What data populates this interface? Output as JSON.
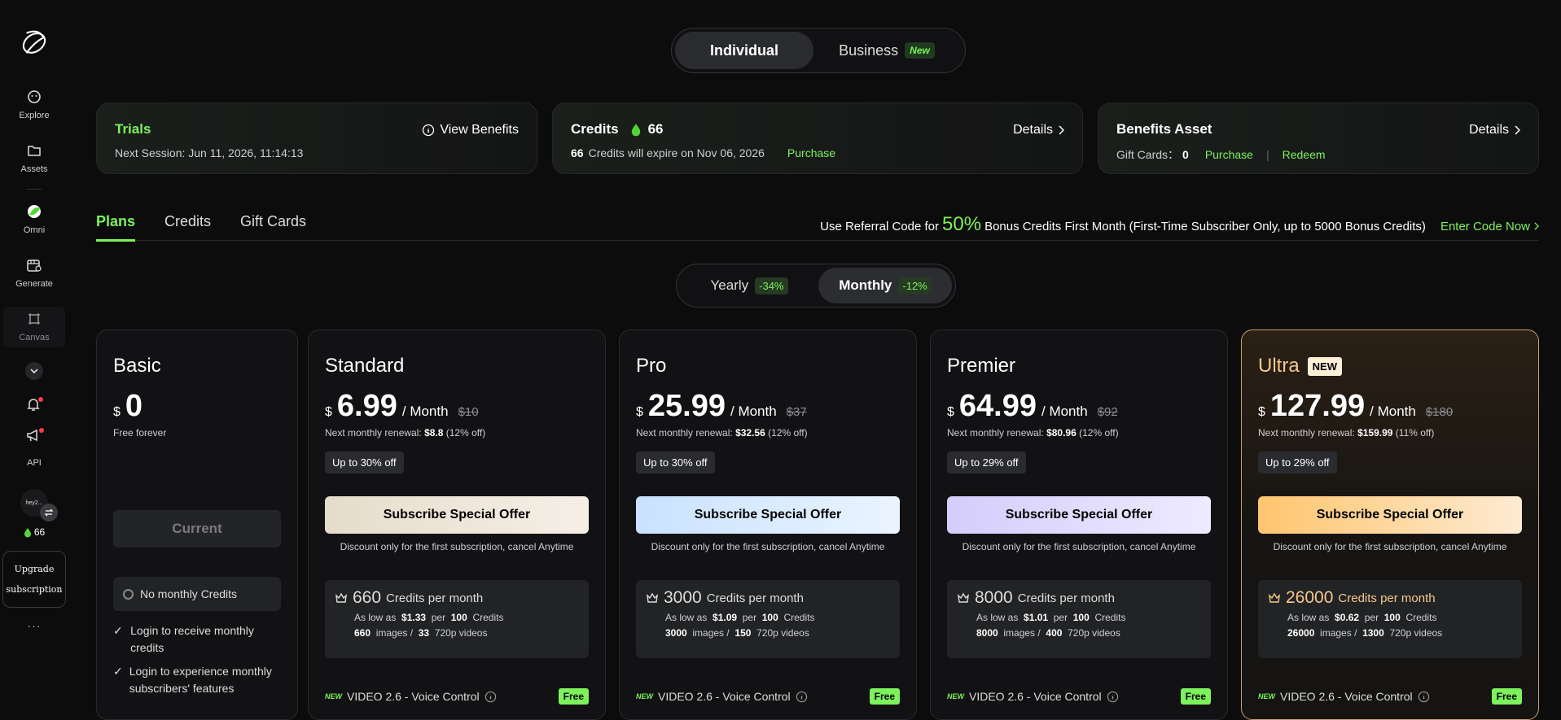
{
  "sidebar": {
    "items": [
      {
        "label": "Explore",
        "icon": "explore-icon"
      },
      {
        "label": "Assets",
        "icon": "folder-icon"
      },
      {
        "label": "Omni",
        "icon": "omni-icon"
      },
      {
        "label": "Generate",
        "icon": "generate-icon"
      },
      {
        "label": "Canvas",
        "icon": "canvas-icon"
      }
    ],
    "api_label": "API",
    "avatar_text": "hey2...",
    "credits": "66",
    "upgrade_line1": "Upgrade",
    "upgrade_line2": "subscription",
    "more": "···"
  },
  "top_segment": {
    "individual": "Individual",
    "business": "Business",
    "business_badge": "New"
  },
  "cards": {
    "trials": {
      "title": "Trials",
      "subtitle": "Next Session: Jun 11, 2026, 11:14:13",
      "action": "View Benefits"
    },
    "credits": {
      "title": "Credits",
      "amount": "66",
      "expire_count": "66",
      "expire_text": "Credits will expire on Nov 06, 2026",
      "purchase": "Purchase",
      "action": "Details"
    },
    "benefits": {
      "title": "Benefits Asset",
      "gift_label": "Gift Cards：",
      "gift_count": "0",
      "purchase": "Purchase",
      "sep": "|",
      "redeem": "Redeem",
      "action": "Details"
    }
  },
  "tabs": [
    {
      "label": "Plans"
    },
    {
      "label": "Credits"
    },
    {
      "label": "Gift Cards"
    }
  ],
  "referral": {
    "prefix": "Use Referral Code for",
    "pct": "50%",
    "suffix": "Bonus Credits First Month (First-Time Subscriber Only, up to 5000 Bonus Credits)",
    "cta": "Enter Code Now"
  },
  "billing": {
    "yearly": "Yearly",
    "yearly_disc": "-34%",
    "monthly": "Monthly",
    "monthly_disc": "-12%"
  },
  "basic": {
    "name": "Basic",
    "currency": "$",
    "price": "0",
    "free": "Free forever",
    "current": "Current",
    "no_credits": "No monthly Credits",
    "check1": "Login to receive monthly credits",
    "check2": "Login to experience monthly subscribers' features"
  },
  "plans": [
    {
      "name": "Standard",
      "currency": "$",
      "price": "6.99",
      "per": "/ Month",
      "old": "$10",
      "renew_prefix": "Next monthly renewal:",
      "renew_amt": "$8.8",
      "renew_off": "(12% off)",
      "off": "Up to 30% off",
      "btn": "Subscribe Special Offer",
      "note": "Discount only for the first subscription, cancel Anytime",
      "credits": "660",
      "credits_label": "Credits per month",
      "as_low": "As low as",
      "low_price": "$1.33",
      "per_word": "per",
      "per_num": "100",
      "credits_word": "Credits",
      "images": "660",
      "images_word": "images /",
      "videos": "33",
      "videos_word": "720p videos",
      "feature_new": "NEW",
      "feature": "VIDEO 2.6 - Voice Control",
      "feature_tag": "Free",
      "grad": "linear-gradient(90deg,#e6dccb,#f5efe6)"
    },
    {
      "name": "Pro",
      "currency": "$",
      "price": "25.99",
      "per": "/ Month",
      "old": "$37",
      "renew_prefix": "Next monthly renewal:",
      "renew_amt": "$32.56",
      "renew_off": "(12% off)",
      "off": "Up to 30% off",
      "btn": "Subscribe Special Offer",
      "note": "Discount only for the first subscription, cancel Anytime",
      "credits": "3000",
      "credits_label": "Credits per month",
      "as_low": "As low as",
      "low_price": "$1.09",
      "per_word": "per",
      "per_num": "100",
      "credits_word": "Credits",
      "images": "3000",
      "images_word": "images /",
      "videos": "150",
      "videos_word": "720p videos",
      "feature_new": "NEW",
      "feature": "VIDEO 2.6 - Voice Control",
      "feature_tag": "Free",
      "grad": "linear-gradient(90deg,#c9e2ff,#eaf4ff)"
    },
    {
      "name": "Premier",
      "currency": "$",
      "price": "64.99",
      "per": "/ Month",
      "old": "$92",
      "renew_prefix": "Next monthly renewal:",
      "renew_amt": "$80.96",
      "renew_off": "(12% off)",
      "off": "Up to 29% off",
      "btn": "Subscribe Special Offer",
      "note": "Discount only for the first subscription, cancel Anytime",
      "credits": "8000",
      "credits_label": "Credits per month",
      "as_low": "As low as",
      "low_price": "$1.01",
      "per_word": "per",
      "per_num": "100",
      "credits_word": "Credits",
      "images": "8000",
      "images_word": "images /",
      "videos": "400",
      "videos_word": "720p videos",
      "feature_new": "NEW",
      "feature": "VIDEO 2.6 - Voice Control",
      "feature_tag": "Free",
      "grad": "linear-gradient(90deg,#d3cdfb,#eeebff)"
    },
    {
      "name": "Ultra",
      "badge": "NEW",
      "currency": "$",
      "price": "127.99",
      "per": "/ Month",
      "old": "$180",
      "renew_prefix": "Next monthly renewal:",
      "renew_amt": "$159.99",
      "renew_off": "(11% off)",
      "off": "Up to 29% off",
      "btn": "Subscribe Special Offer",
      "note": "Discount only for the first subscription, cancel Anytime",
      "credits": "26000",
      "credits_label": "Credits per month",
      "as_low": "As low as",
      "low_price": "$0.62",
      "per_word": "per",
      "per_num": "100",
      "credits_word": "Credits",
      "images": "26000",
      "images_word": "images /",
      "videos": "1300",
      "videos_word": "720p videos",
      "feature_new": "NEW",
      "feature": "VIDEO 2.6 - Voice Control",
      "feature_tag": "Free",
      "grad": "linear-gradient(90deg,#ffc56e,#fdebd2)"
    }
  ],
  "colors": {
    "accent": "#7cf25b",
    "bg": "#0c0c0d",
    "ultra_border": "#c9a06a"
  }
}
